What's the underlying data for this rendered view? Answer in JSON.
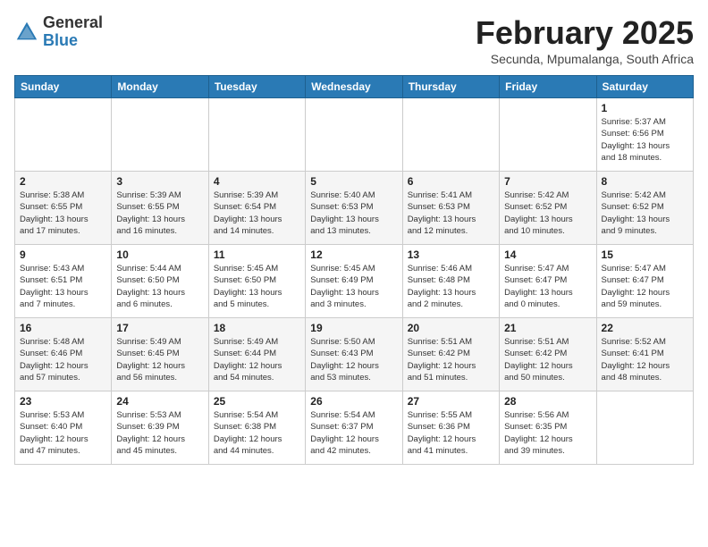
{
  "logo": {
    "general": "General",
    "blue": "Blue"
  },
  "header": {
    "month": "February 2025",
    "location": "Secunda, Mpumalanga, South Africa"
  },
  "days_of_week": [
    "Sunday",
    "Monday",
    "Tuesday",
    "Wednesday",
    "Thursday",
    "Friday",
    "Saturday"
  ],
  "weeks": [
    [
      {
        "day": "",
        "info": ""
      },
      {
        "day": "",
        "info": ""
      },
      {
        "day": "",
        "info": ""
      },
      {
        "day": "",
        "info": ""
      },
      {
        "day": "",
        "info": ""
      },
      {
        "day": "",
        "info": ""
      },
      {
        "day": "1",
        "info": "Sunrise: 5:37 AM\nSunset: 6:56 PM\nDaylight: 13 hours\nand 18 minutes."
      }
    ],
    [
      {
        "day": "2",
        "info": "Sunrise: 5:38 AM\nSunset: 6:55 PM\nDaylight: 13 hours\nand 17 minutes."
      },
      {
        "day": "3",
        "info": "Sunrise: 5:39 AM\nSunset: 6:55 PM\nDaylight: 13 hours\nand 16 minutes."
      },
      {
        "day": "4",
        "info": "Sunrise: 5:39 AM\nSunset: 6:54 PM\nDaylight: 13 hours\nand 14 minutes."
      },
      {
        "day": "5",
        "info": "Sunrise: 5:40 AM\nSunset: 6:53 PM\nDaylight: 13 hours\nand 13 minutes."
      },
      {
        "day": "6",
        "info": "Sunrise: 5:41 AM\nSunset: 6:53 PM\nDaylight: 13 hours\nand 12 minutes."
      },
      {
        "day": "7",
        "info": "Sunrise: 5:42 AM\nSunset: 6:52 PM\nDaylight: 13 hours\nand 10 minutes."
      },
      {
        "day": "8",
        "info": "Sunrise: 5:42 AM\nSunset: 6:52 PM\nDaylight: 13 hours\nand 9 minutes."
      }
    ],
    [
      {
        "day": "9",
        "info": "Sunrise: 5:43 AM\nSunset: 6:51 PM\nDaylight: 13 hours\nand 7 minutes."
      },
      {
        "day": "10",
        "info": "Sunrise: 5:44 AM\nSunset: 6:50 PM\nDaylight: 13 hours\nand 6 minutes."
      },
      {
        "day": "11",
        "info": "Sunrise: 5:45 AM\nSunset: 6:50 PM\nDaylight: 13 hours\nand 5 minutes."
      },
      {
        "day": "12",
        "info": "Sunrise: 5:45 AM\nSunset: 6:49 PM\nDaylight: 13 hours\nand 3 minutes."
      },
      {
        "day": "13",
        "info": "Sunrise: 5:46 AM\nSunset: 6:48 PM\nDaylight: 13 hours\nand 2 minutes."
      },
      {
        "day": "14",
        "info": "Sunrise: 5:47 AM\nSunset: 6:47 PM\nDaylight: 13 hours\nand 0 minutes."
      },
      {
        "day": "15",
        "info": "Sunrise: 5:47 AM\nSunset: 6:47 PM\nDaylight: 12 hours\nand 59 minutes."
      }
    ],
    [
      {
        "day": "16",
        "info": "Sunrise: 5:48 AM\nSunset: 6:46 PM\nDaylight: 12 hours\nand 57 minutes."
      },
      {
        "day": "17",
        "info": "Sunrise: 5:49 AM\nSunset: 6:45 PM\nDaylight: 12 hours\nand 56 minutes."
      },
      {
        "day": "18",
        "info": "Sunrise: 5:49 AM\nSunset: 6:44 PM\nDaylight: 12 hours\nand 54 minutes."
      },
      {
        "day": "19",
        "info": "Sunrise: 5:50 AM\nSunset: 6:43 PM\nDaylight: 12 hours\nand 53 minutes."
      },
      {
        "day": "20",
        "info": "Sunrise: 5:51 AM\nSunset: 6:42 PM\nDaylight: 12 hours\nand 51 minutes."
      },
      {
        "day": "21",
        "info": "Sunrise: 5:51 AM\nSunset: 6:42 PM\nDaylight: 12 hours\nand 50 minutes."
      },
      {
        "day": "22",
        "info": "Sunrise: 5:52 AM\nSunset: 6:41 PM\nDaylight: 12 hours\nand 48 minutes."
      }
    ],
    [
      {
        "day": "23",
        "info": "Sunrise: 5:53 AM\nSunset: 6:40 PM\nDaylight: 12 hours\nand 47 minutes."
      },
      {
        "day": "24",
        "info": "Sunrise: 5:53 AM\nSunset: 6:39 PM\nDaylight: 12 hours\nand 45 minutes."
      },
      {
        "day": "25",
        "info": "Sunrise: 5:54 AM\nSunset: 6:38 PM\nDaylight: 12 hours\nand 44 minutes."
      },
      {
        "day": "26",
        "info": "Sunrise: 5:54 AM\nSunset: 6:37 PM\nDaylight: 12 hours\nand 42 minutes."
      },
      {
        "day": "27",
        "info": "Sunrise: 5:55 AM\nSunset: 6:36 PM\nDaylight: 12 hours\nand 41 minutes."
      },
      {
        "day": "28",
        "info": "Sunrise: 5:56 AM\nSunset: 6:35 PM\nDaylight: 12 hours\nand 39 minutes."
      },
      {
        "day": "",
        "info": ""
      }
    ]
  ]
}
